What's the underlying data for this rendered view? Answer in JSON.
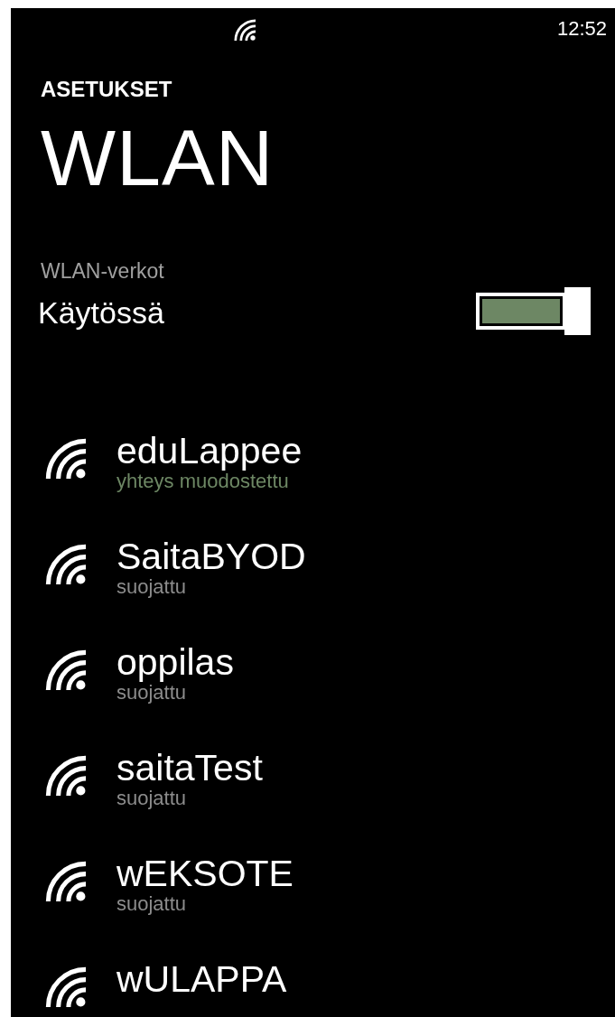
{
  "status_bar": {
    "time": "12:52"
  },
  "header": {
    "app_title": "ASETUKSET",
    "page_title": "WLAN"
  },
  "wlan_toggle": {
    "label": "WLAN-verkot",
    "state_text": "Käytössä",
    "on": true
  },
  "networks": [
    {
      "name": "eduLappee",
      "status": "yhteys muodostettu",
      "connected": true
    },
    {
      "name": "SaitaBYOD",
      "status": "suojattu",
      "connected": false
    },
    {
      "name": "oppilas",
      "status": "suojattu",
      "connected": false
    },
    {
      "name": "saitaTest",
      "status": "suojattu",
      "connected": false
    },
    {
      "name": "wEKSOTE",
      "status": "suojattu",
      "connected": false
    },
    {
      "name": "wULAPPA"
    }
  ]
}
